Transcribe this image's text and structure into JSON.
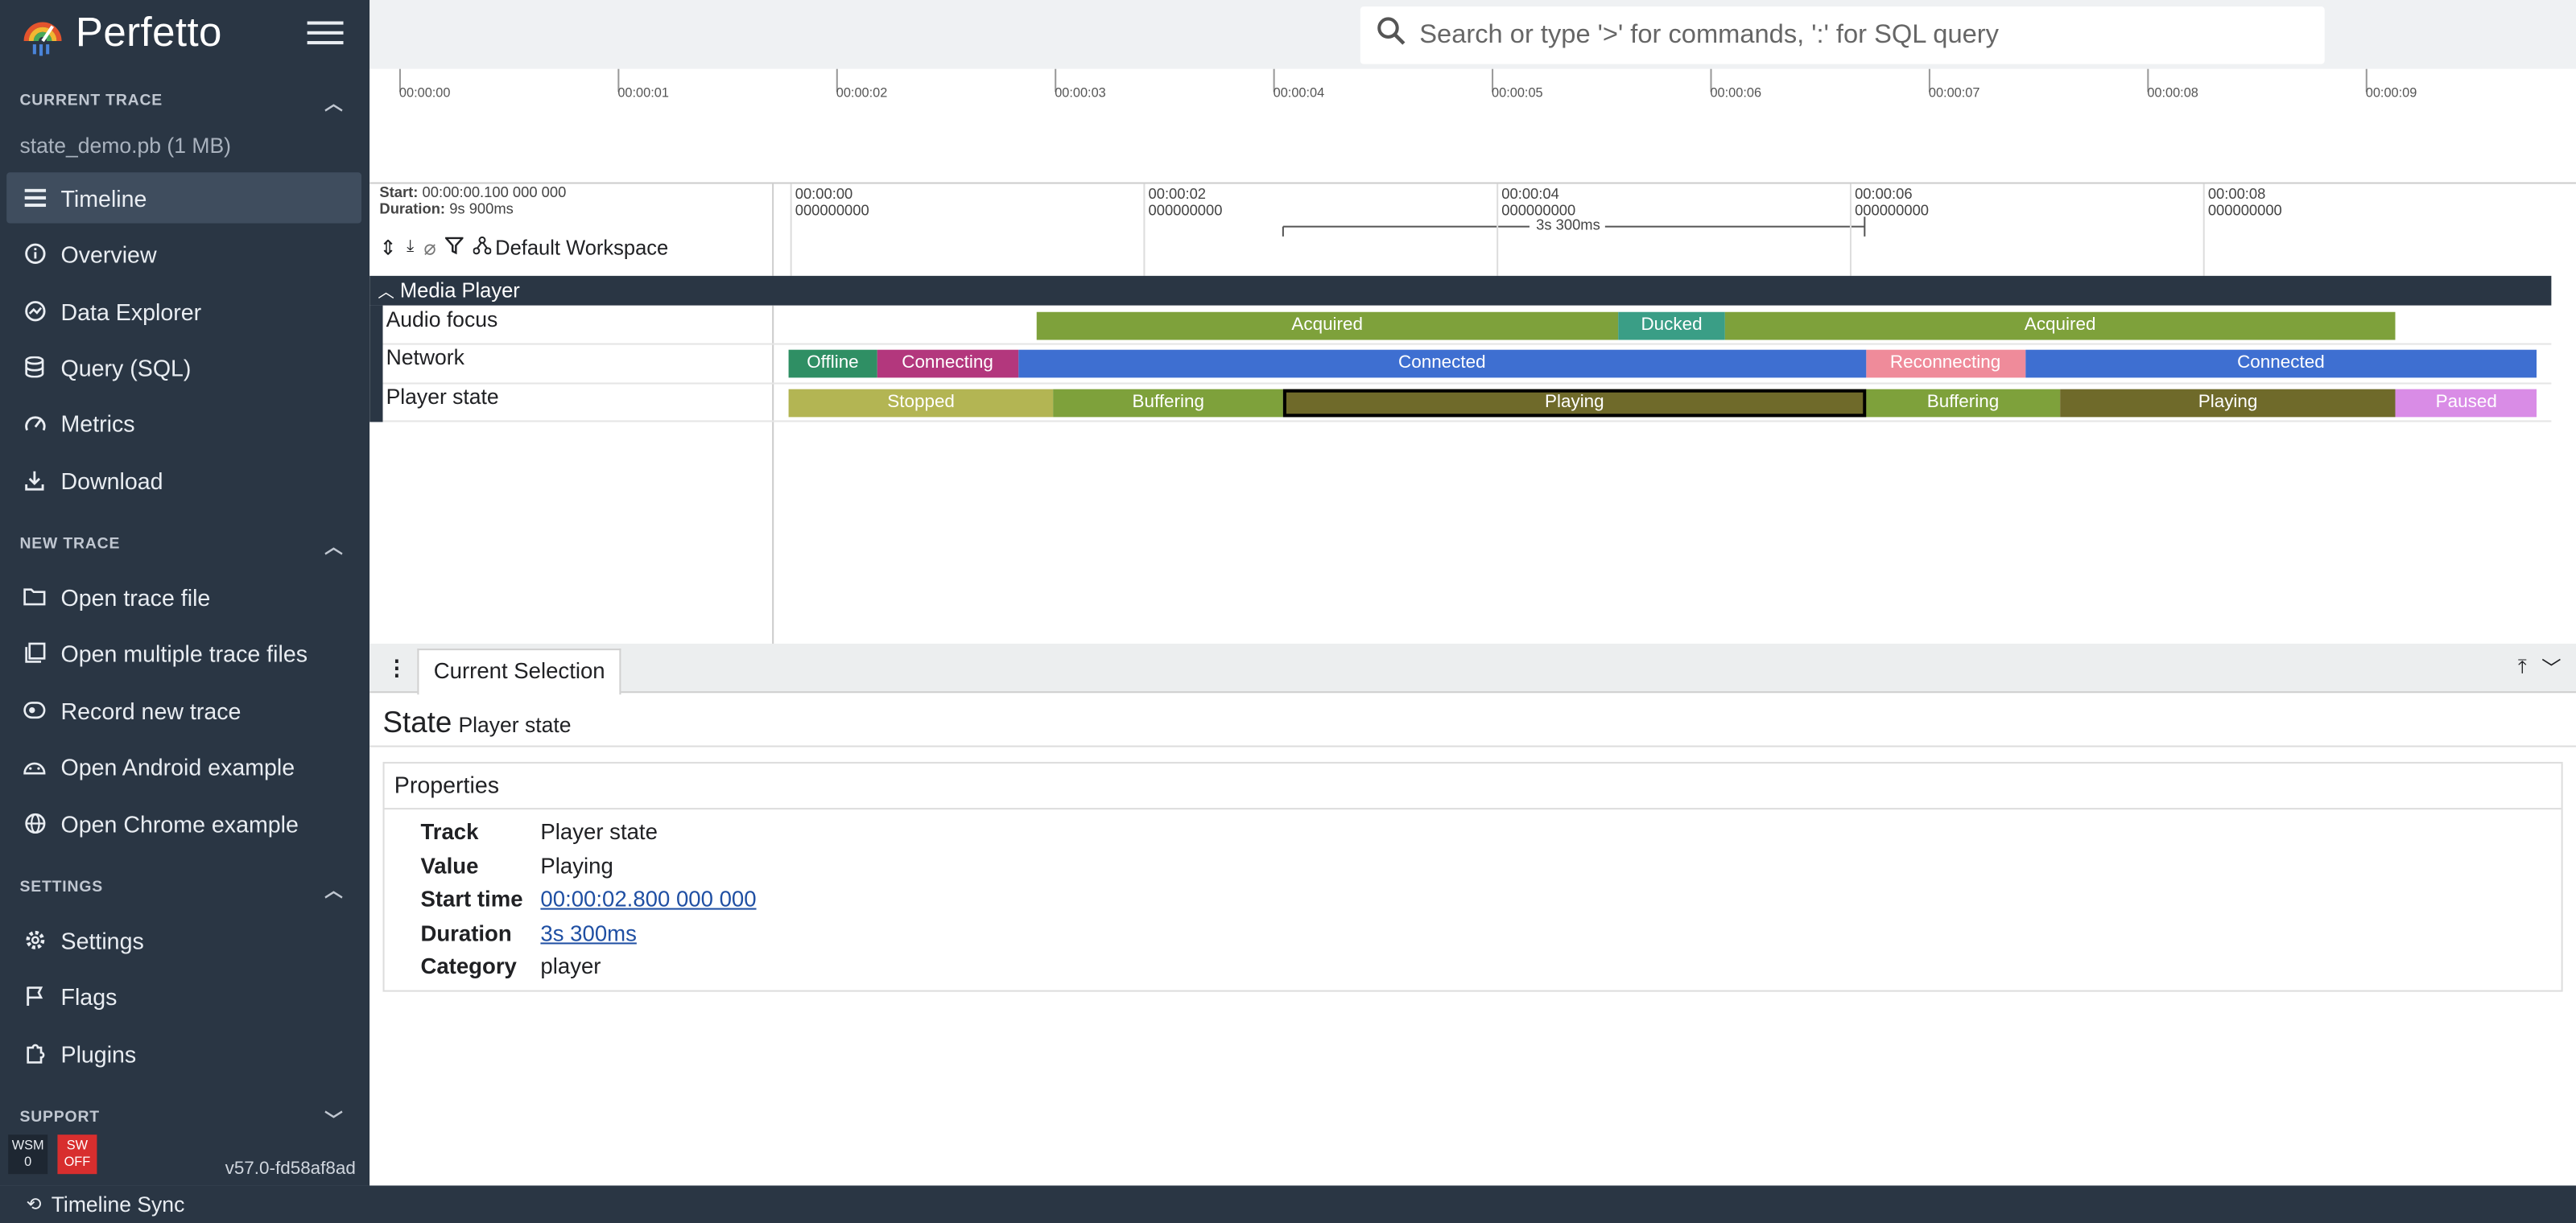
{
  "app": {
    "name": "Perfetto"
  },
  "sidebar": {
    "current_trace_header": "CURRENT TRACE",
    "trace_name": "state_demo.pb (1 MB)",
    "trace_items": [
      {
        "label": "Timeline",
        "icon": "timeline-icon"
      },
      {
        "label": "Overview",
        "icon": "info-icon"
      },
      {
        "label": "Data Explorer",
        "icon": "explore-icon"
      },
      {
        "label": "Query (SQL)",
        "icon": "database-icon"
      },
      {
        "label": "Metrics",
        "icon": "speed-icon"
      },
      {
        "label": "Download",
        "icon": "download-icon"
      }
    ],
    "new_trace_header": "NEW TRACE",
    "new_trace_items": [
      {
        "label": "Open trace file",
        "icon": "folder-icon"
      },
      {
        "label": "Open multiple trace files",
        "icon": "library-icon"
      },
      {
        "label": "Record new trace",
        "icon": "record-icon"
      },
      {
        "label": "Open Android example",
        "icon": "android-icon"
      },
      {
        "label": "Open Chrome example",
        "icon": "globe-icon"
      }
    ],
    "settings_header": "SETTINGS",
    "settings_items": [
      {
        "label": "Settings",
        "icon": "gear-icon"
      },
      {
        "label": "Flags",
        "icon": "flag-icon"
      },
      {
        "label": "Plugins",
        "icon": "extension-icon"
      }
    ],
    "support_header": "SUPPORT",
    "wsm": {
      "line1": "WSM",
      "line2": "0"
    },
    "sw": {
      "line1": "SW",
      "line2": "OFF"
    },
    "version": "v57.0-fd58af8ad"
  },
  "search": {
    "placeholder": "Search or type '>' for commands, ':' for SQL query"
  },
  "overview": {
    "ticks": [
      "00:00:00",
      "00:00:01",
      "00:00:02",
      "00:00:03",
      "00:00:04",
      "00:00:05",
      "00:00:06",
      "00:00:07",
      "00:00:08",
      "00:00:09"
    ]
  },
  "timeline_header": {
    "start_label": "Start:",
    "start_value": "00:00:00.100 000 000",
    "duration_label": "Duration:",
    "duration_value": "9s 900ms",
    "workspace": "Default Workspace",
    "ruler_ticks": [
      {
        "time": "00:00:00",
        "sub": "000000000"
      },
      {
        "time": "00:00:02",
        "sub": "000000000"
      },
      {
        "time": "00:00:04",
        "sub": "000000000"
      },
      {
        "time": "00:00:06",
        "sub": "000000000"
      },
      {
        "time": "00:00:08",
        "sub": "000000000"
      }
    ],
    "span_label": "3s 300ms"
  },
  "tracks": {
    "group_name": "Media Player",
    "lanes": [
      {
        "name": "Audio focus",
        "slices": [
          {
            "label": "Acquired",
            "start": 1.4,
            "end": 4.7,
            "color": "#7ea13b"
          },
          {
            "label": "Ducked",
            "start": 4.7,
            "end": 5.3,
            "color": "#3a9e86"
          },
          {
            "label": "Acquired",
            "start": 5.3,
            "end": 9.1,
            "color": "#7ea13b"
          }
        ]
      },
      {
        "name": "Network",
        "slices": [
          {
            "label": "Offline",
            "start": 0.0,
            "end": 0.5,
            "color": "#2f8f64"
          },
          {
            "label": "Connecting",
            "start": 0.5,
            "end": 1.3,
            "color": "#b3377d"
          },
          {
            "label": "Connected",
            "start": 1.3,
            "end": 6.1,
            "color": "#3e6fd1"
          },
          {
            "label": "Reconnecting",
            "start": 6.1,
            "end": 7.0,
            "color": "#ef8b9a"
          },
          {
            "label": "Connected",
            "start": 7.0,
            "end": 9.9,
            "color": "#3e6fd1"
          }
        ]
      },
      {
        "name": "Player state",
        "slices": [
          {
            "label": "Stopped",
            "start": 0.0,
            "end": 1.5,
            "color": "#b3b553"
          },
          {
            "label": "Buffering",
            "start": 1.5,
            "end": 2.8,
            "color": "#7ea13b"
          },
          {
            "label": "Playing",
            "start": 2.8,
            "end": 6.1,
            "color": "#6f6a2a",
            "selected": true
          },
          {
            "label": "Buffering",
            "start": 6.1,
            "end": 7.2,
            "color": "#7ea13b"
          },
          {
            "label": "Playing",
            "start": 7.2,
            "end": 9.1,
            "color": "#6f6a2a"
          },
          {
            "label": "Paused",
            "start": 9.1,
            "end": 9.9,
            "color": "#d98ce6"
          }
        ]
      }
    ]
  },
  "details": {
    "tab": "Current Selection",
    "title": "State",
    "subtitle": "Player state",
    "properties_header": "Properties",
    "rows": [
      {
        "key": "Track",
        "value": "Player state",
        "link": false
      },
      {
        "key": "Value",
        "value": "Playing",
        "link": false
      },
      {
        "key": "Start time",
        "value": "00:00:02.800 000 000",
        "link": true
      },
      {
        "key": "Duration",
        "value": "3s 300ms",
        "link": true
      },
      {
        "key": "Category",
        "value": "player",
        "link": false
      }
    ]
  },
  "statusbar": {
    "label": "Timeline Sync"
  }
}
